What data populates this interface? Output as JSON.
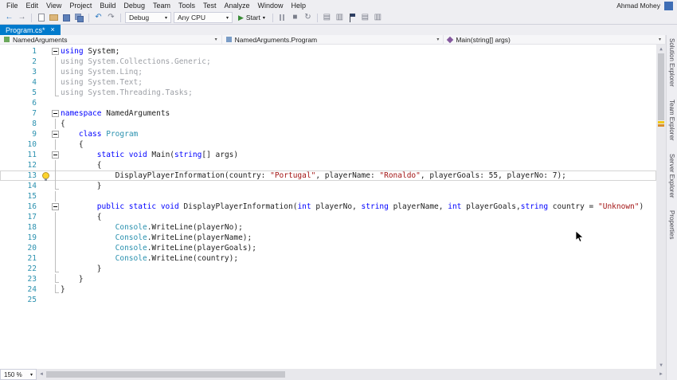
{
  "titlebar": {
    "user": "Ahmad Mohey"
  },
  "menu": {
    "items": [
      "File",
      "Edit",
      "View",
      "Project",
      "Build",
      "Debug",
      "Team",
      "Tools",
      "Test",
      "Analyze",
      "Window",
      "Help"
    ]
  },
  "toolbar": {
    "debug_label": "Debug",
    "cpu_label": "Any CPU",
    "start_label": "Start"
  },
  "tab": {
    "label": "Program.cs*"
  },
  "navbar": {
    "scopes": [
      "NamedArguments",
      "NamedArguments.Program",
      "Main(string[] args)"
    ]
  },
  "glyphs": {
    "dropdown": "▾",
    "close": "×",
    "play": "▶",
    "back": "←",
    "forward": "→",
    "undo": "↶",
    "redo": "↷",
    "stop": "■",
    "restart": "↻",
    "up": "▲",
    "down": "▼",
    "left": "◄",
    "right": "►",
    "grid": "▤",
    "list": "▥"
  },
  "editor": {
    "lines": [
      {
        "n": 1,
        "o": "m",
        "tokens": [
          [
            "k",
            "using "
          ],
          [
            "n",
            "System;"
          ]
        ]
      },
      {
        "n": 2,
        "o": "b",
        "tokens": [
          [
            "g",
            "using System.Collections.Generic;"
          ]
        ]
      },
      {
        "n": 3,
        "o": "b",
        "tokens": [
          [
            "g",
            "using System.Linq;"
          ]
        ]
      },
      {
        "n": 4,
        "o": "b",
        "tokens": [
          [
            "g",
            "using System.Text;"
          ]
        ]
      },
      {
        "n": 5,
        "o": "e",
        "tokens": [
          [
            "g",
            "using System.Threading.Tasks;"
          ]
        ]
      },
      {
        "n": 6,
        "o": "",
        "tokens": []
      },
      {
        "n": 7,
        "o": "m",
        "tokens": [
          [
            "k",
            "namespace "
          ],
          [
            "n",
            "NamedArguments"
          ]
        ]
      },
      {
        "n": 8,
        "o": "b",
        "tokens": [
          [
            "n",
            "{"
          ]
        ]
      },
      {
        "n": 9,
        "o": "m",
        "tokens": [
          [
            "n",
            "    "
          ],
          [
            "k",
            "class "
          ],
          [
            "t",
            "Program"
          ]
        ]
      },
      {
        "n": 10,
        "o": "b",
        "tokens": [
          [
            "n",
            "    {"
          ]
        ]
      },
      {
        "n": 11,
        "o": "m",
        "tokens": [
          [
            "n",
            "        "
          ],
          [
            "k",
            "static void "
          ],
          [
            "n",
            "Main("
          ],
          [
            "k",
            "string"
          ],
          [
            "n",
            "[] args)"
          ]
        ]
      },
      {
        "n": 12,
        "o": "b",
        "tokens": [
          [
            "n",
            "        {"
          ]
        ]
      },
      {
        "n": 13,
        "o": "b",
        "bulb": true,
        "current": true,
        "tokens": [
          [
            "n",
            "            DisplayPlayerInformation(country: "
          ],
          [
            "s",
            "\"Portugal\""
          ],
          [
            "n",
            ", playerName: "
          ],
          [
            "s",
            "\"Ronaldo\""
          ],
          [
            "n",
            ", playerGoals: 55, playerNo: 7);"
          ]
        ]
      },
      {
        "n": 14,
        "o": "e",
        "tokens": [
          [
            "n",
            "        }"
          ]
        ]
      },
      {
        "n": 15,
        "o": "b",
        "tokens": []
      },
      {
        "n": 16,
        "o": "m",
        "tokens": [
          [
            "n",
            "        "
          ],
          [
            "k",
            "public static void "
          ],
          [
            "n",
            "DisplayPlayerInformation("
          ],
          [
            "k",
            "int"
          ],
          [
            "n",
            " playerNo, "
          ],
          [
            "k",
            "string"
          ],
          [
            "n",
            " playerName, "
          ],
          [
            "k",
            "int"
          ],
          [
            "n",
            " playerGoals,"
          ],
          [
            "k",
            "string"
          ],
          [
            "n",
            " country = "
          ],
          [
            "s",
            "\"Unknown\""
          ],
          [
            "n",
            ")"
          ]
        ]
      },
      {
        "n": 17,
        "o": "b",
        "tokens": [
          [
            "n",
            "        {"
          ]
        ]
      },
      {
        "n": 18,
        "o": "b",
        "tokens": [
          [
            "n",
            "            "
          ],
          [
            "t",
            "Console"
          ],
          [
            "n",
            ".WriteLine(playerNo);"
          ]
        ]
      },
      {
        "n": 19,
        "o": "b",
        "tokens": [
          [
            "n",
            "            "
          ],
          [
            "t",
            "Console"
          ],
          [
            "n",
            ".WriteLine(playerName);"
          ]
        ]
      },
      {
        "n": 20,
        "o": "b",
        "tokens": [
          [
            "n",
            "            "
          ],
          [
            "t",
            "Console"
          ],
          [
            "n",
            ".WriteLine(playerGoals);"
          ]
        ]
      },
      {
        "n": 21,
        "o": "b",
        "tokens": [
          [
            "n",
            "            "
          ],
          [
            "t",
            "Console"
          ],
          [
            "n",
            ".WriteLine(country);"
          ]
        ]
      },
      {
        "n": 22,
        "o": "e",
        "tokens": [
          [
            "n",
            "        }"
          ]
        ]
      },
      {
        "n": 23,
        "o": "e",
        "tokens": [
          [
            "n",
            "    }"
          ]
        ]
      },
      {
        "n": 24,
        "o": "e",
        "tokens": [
          [
            "n",
            "}"
          ]
        ]
      },
      {
        "n": 25,
        "o": "",
        "tokens": []
      }
    ]
  },
  "side_tabs": {
    "items": [
      "Solution Explorer",
      "Team Explorer",
      "Server Explorer",
      "Properties"
    ]
  },
  "status": {
    "zoom": "150 %"
  }
}
